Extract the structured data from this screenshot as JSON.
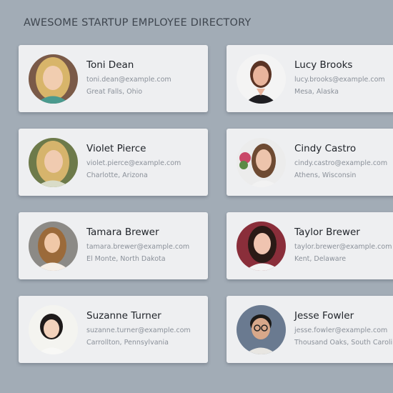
{
  "header": {
    "title": "AWESOME STARTUP EMPLOYEE DIRECTORY"
  },
  "employees": [
    {
      "name": "Toni Dean",
      "email": "toni.dean@example.com",
      "location": "Great Falls, Ohio",
      "avatar": "woman-blonde-avatar"
    },
    {
      "name": "Lucy Brooks",
      "email": "lucy.brooks@example.com",
      "location": "Mesa, Alaska",
      "avatar": "woman-brunette-avatar"
    },
    {
      "name": "Violet Pierce",
      "email": "violet.pierce@example.com",
      "location": "Charlotte, Arizona",
      "avatar": "woman-blonde-avatar"
    },
    {
      "name": "Cindy Castro",
      "email": "cindy.castro@example.com",
      "location": "Athens, Wisconsin",
      "avatar": "woman-brunette-avatar"
    },
    {
      "name": "Tamara Brewer",
      "email": "tamara.brewer@example.com",
      "location": "El Monte, North Dakota",
      "avatar": "woman-light-brown-hair-avatar"
    },
    {
      "name": "Taylor Brewer",
      "email": "taylor.brewer@example.com",
      "location": "Kent, Delaware",
      "avatar": "woman-dark-hair-avatar"
    },
    {
      "name": "Suzanne Turner",
      "email": "suzanne.turner@example.com",
      "location": "Carrollton, Pennsylvania",
      "avatar": "woman-black-hair-avatar"
    },
    {
      "name": "Jesse Fowler",
      "email": "jesse.fowler@example.com",
      "location": "Thousand Oaks, South Carolina",
      "avatar": "man-dark-hair-glasses-avatar"
    }
  ]
}
